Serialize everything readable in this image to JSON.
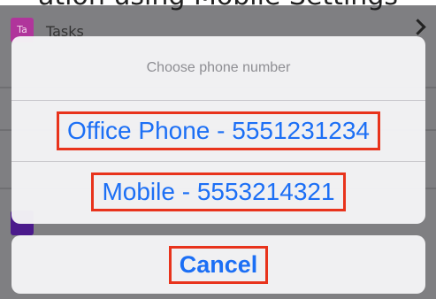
{
  "page_caption_fragment": "ation using Mobile Settings",
  "background_list": {
    "first_row": {
      "avatar_text": "Ta",
      "label": "Tasks"
    }
  },
  "action_sheet": {
    "title": "Choose phone number",
    "options": [
      {
        "label": "Office Phone - 5551231234"
      },
      {
        "label": "Mobile - 5553214321"
      }
    ],
    "cancel_label": "Cancel"
  },
  "colors": {
    "action_blue": "#1c6ff5",
    "highlight_red": "#e8331c",
    "title_gray": "#8e8e93",
    "avatar_magenta": "#b0359b",
    "avatar_purple": "#4b1a8c"
  }
}
